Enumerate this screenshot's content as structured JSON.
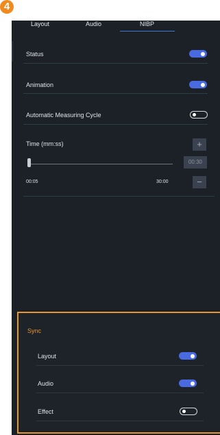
{
  "badge": "4",
  "tabs": [
    {
      "label": "Layout",
      "active": false
    },
    {
      "label": "Audio",
      "active": false
    },
    {
      "label": "NIBP",
      "active": true
    }
  ],
  "settings": {
    "status": {
      "label": "Status",
      "on": true
    },
    "animation": {
      "label": "Animation",
      "on": true
    },
    "auto_cycle": {
      "label": "Automatic Measuring Cycle",
      "on": false
    }
  },
  "time": {
    "label": "Time (mm:ss)",
    "value": "00:30",
    "min_label": "00:05",
    "max_label": "30:00",
    "plus_icon": "plus-icon",
    "minus_icon": "minus-icon"
  },
  "sync": {
    "title": "Sync",
    "items": [
      {
        "label": "Layout",
        "on": true
      },
      {
        "label": "Audio",
        "on": true
      },
      {
        "label": "Effect",
        "on": false
      }
    ]
  },
  "colors": {
    "background": "#1c2128",
    "accent": "#4a6ae0",
    "highlight": "#e8962e",
    "tab_underline": "#3a7bd5"
  }
}
